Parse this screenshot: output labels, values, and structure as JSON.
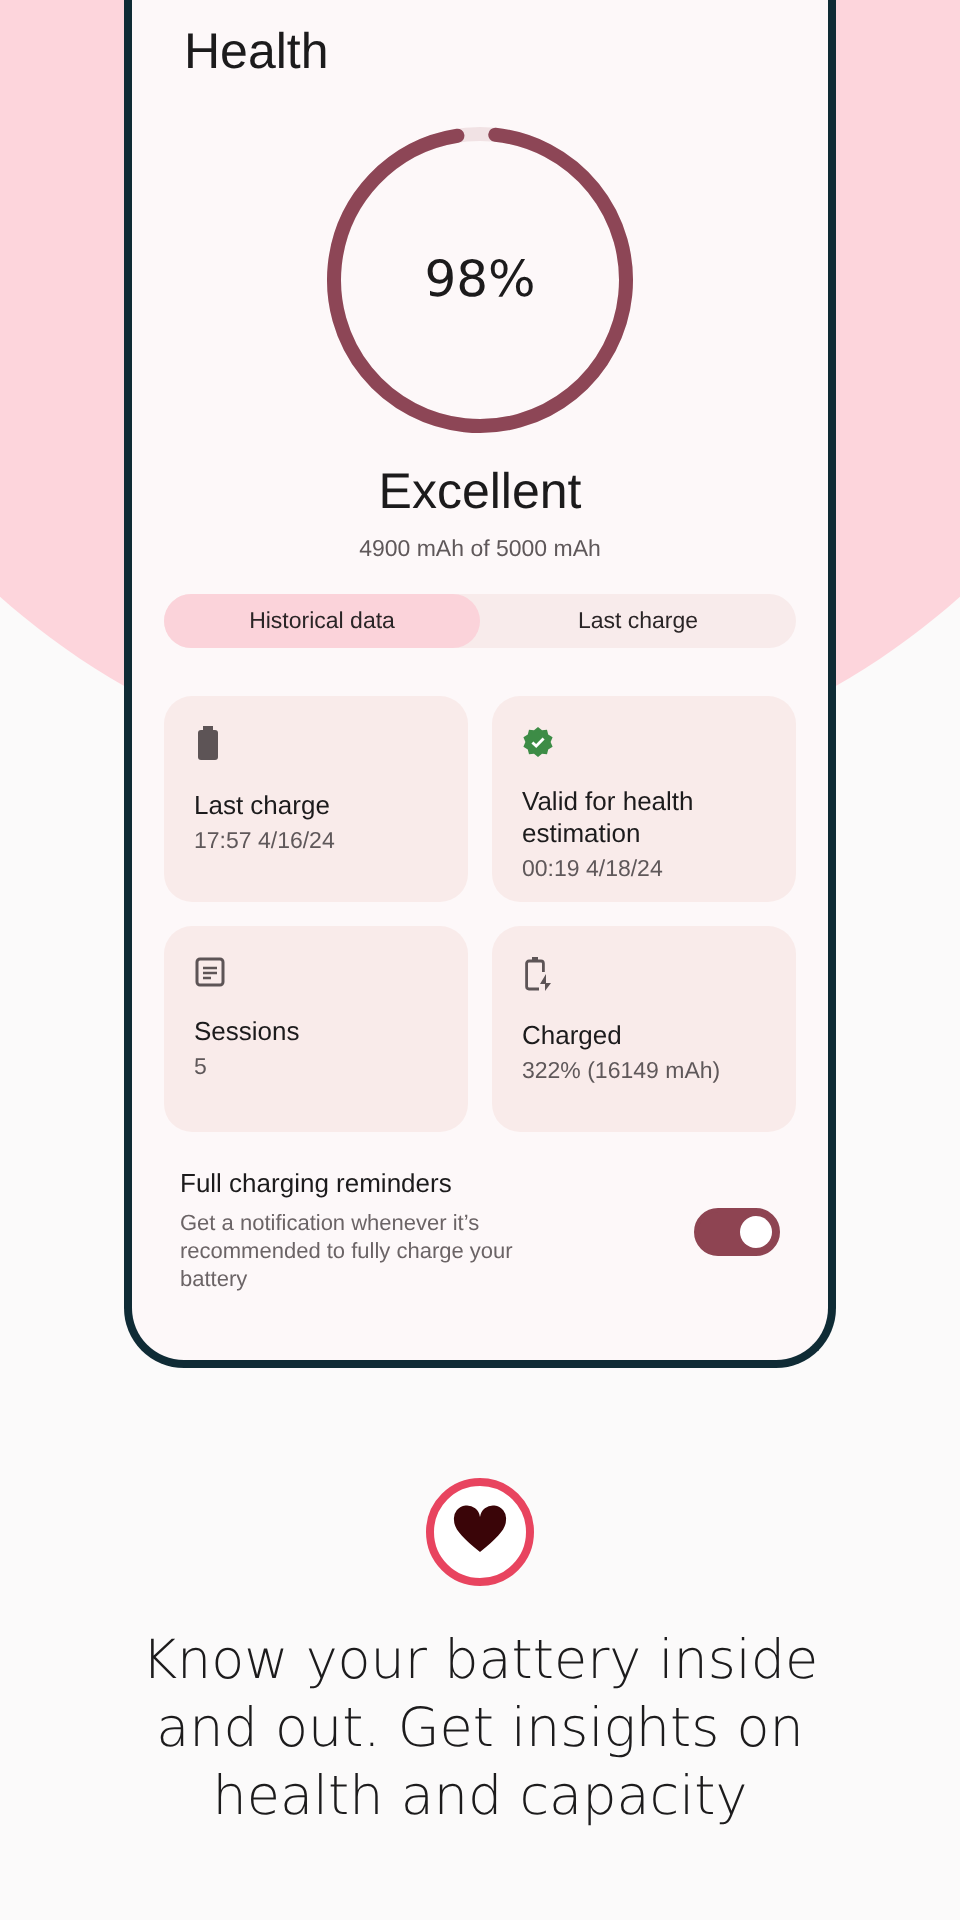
{
  "screen": {
    "title": "Health"
  },
  "gauge": {
    "level": 0.98,
    "value": "98%",
    "rating": "Excellent",
    "capacity": "4900 mAh of 5000 mAh"
  },
  "tabs": [
    {
      "label": "Historical data",
      "selected": true
    },
    {
      "label": "Last charge",
      "selected": false
    }
  ],
  "cards": [
    {
      "kind": "battery",
      "title": "Last charge",
      "value": "17:57 4/16/24"
    },
    {
      "kind": "verified",
      "title": "Valid for health estimation",
      "value": "00:19 4/18/24"
    },
    {
      "kind": "list",
      "title": "Sessions",
      "value": "5"
    },
    {
      "kind": "charging",
      "title": "Charged",
      "value": "322% (16149 mAh)"
    }
  ],
  "reminder": {
    "title": "Full charging reminders",
    "description": "Get a notification whenever it’s recommended to fully charge your battery",
    "on": true
  },
  "promo": {
    "text": "Know your battery inside and out. Get insights on health and capacity"
  }
}
